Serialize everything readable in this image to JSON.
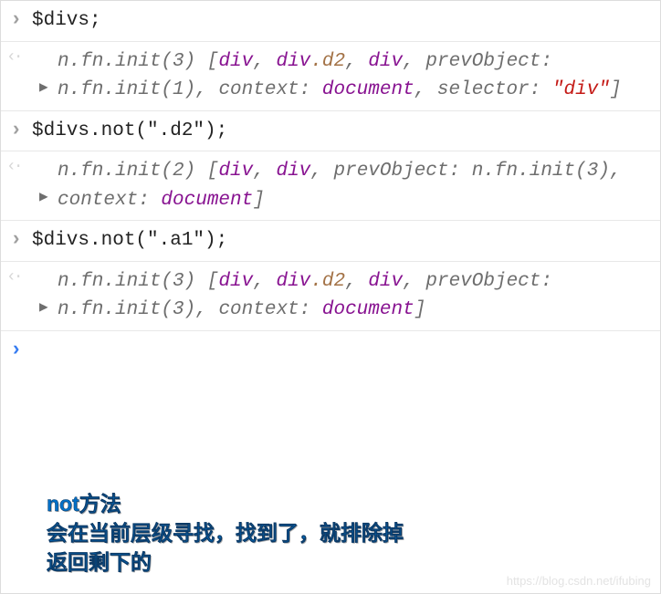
{
  "rows": [
    {
      "type": "input",
      "code": "$divs;"
    },
    {
      "type": "output",
      "tokens": [
        {
          "t": "n.fn.init(3) [",
          "c": "dim"
        },
        {
          "t": "div",
          "c": "purple"
        },
        {
          "t": ", ",
          "c": "dim"
        },
        {
          "t": "div",
          "c": "purple"
        },
        {
          "t": ".",
          "c": "brown"
        },
        {
          "t": "d2",
          "c": "brown"
        },
        {
          "t": ", ",
          "c": "dim"
        },
        {
          "t": "div",
          "c": "purple"
        },
        {
          "t": ", ",
          "c": "dim"
        },
        {
          "t": "pre",
          "c": "dim"
        },
        {
          "t": "vObject: ",
          "c": "dim"
        },
        {
          "t": "n.fn.init(1)",
          "c": "dim"
        },
        {
          "t": ", context: ",
          "c": "dim"
        },
        {
          "t": "document",
          "c": "purple"
        },
        {
          "t": ", selector: ",
          "c": "dim"
        },
        {
          "t": "\"div\"",
          "c": "red"
        },
        {
          "t": "]",
          "c": "dim"
        }
      ]
    },
    {
      "type": "input",
      "code": "$divs.not(\".d2\");"
    },
    {
      "type": "output",
      "tokens": [
        {
          "t": "n.fn.init(2) [",
          "c": "dim"
        },
        {
          "t": "div",
          "c": "purple"
        },
        {
          "t": ", ",
          "c": "dim"
        },
        {
          "t": "div",
          "c": "purple"
        },
        {
          "t": ", prevObject: ",
          "c": "dim"
        },
        {
          "t": "n.fn.init(3)",
          "c": "dim"
        },
        {
          "t": ", context: ",
          "c": "dim"
        },
        {
          "t": "document",
          "c": "purple"
        },
        {
          "t": "]",
          "c": "dim"
        }
      ]
    },
    {
      "type": "input",
      "code": "$divs.not(\".a1\");"
    },
    {
      "type": "output",
      "tokens": [
        {
          "t": "n.fn.init(3) [",
          "c": "dim"
        },
        {
          "t": "div",
          "c": "purple"
        },
        {
          "t": ", ",
          "c": "dim"
        },
        {
          "t": "div",
          "c": "purple"
        },
        {
          "t": ".",
          "c": "brown"
        },
        {
          "t": "d2",
          "c": "brown"
        },
        {
          "t": ", ",
          "c": "dim"
        },
        {
          "t": "div",
          "c": "purple"
        },
        {
          "t": ", ",
          "c": "dim"
        },
        {
          "t": "pre",
          "c": "dim"
        },
        {
          "t": "vObject: ",
          "c": "dim"
        },
        {
          "t": "n.fn.init(3)",
          "c": "dim"
        },
        {
          "t": ", context: ",
          "c": "dim"
        },
        {
          "t": "document",
          "c": "purple"
        },
        {
          "t": "]",
          "c": "dim"
        }
      ]
    },
    {
      "type": "prompt",
      "code": ""
    }
  ],
  "annotation": {
    "line1": "not方法",
    "line2": "会在当前层级寻找，找到了，就排除掉",
    "line3": "返回剩下的"
  },
  "watermark": "https://blog.csdn.net/ifubing"
}
